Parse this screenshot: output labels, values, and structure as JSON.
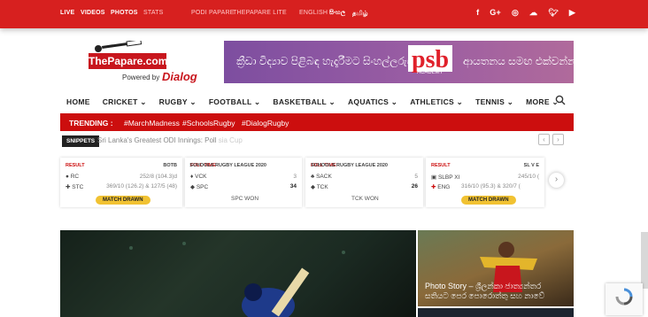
{
  "topbar": {
    "links": [
      "LIVE",
      "VIDEOS",
      "PHOTOS",
      "STATS"
    ],
    "links2": [
      "PODI PAPARE",
      "THEPAPARE LITE"
    ],
    "languages": [
      "ENGLISH",
      "සිංහල",
      "தமிழ்"
    ],
    "social_icons": [
      "facebook-icon",
      "google-plus-icon",
      "instagram-icon",
      "soundcloud-icon",
      "twitter-icon",
      "youtube-icon"
    ]
  },
  "logo": {
    "site": "ThePapare.com",
    "powered_by": "Powered by",
    "sponsor": "Dialog"
  },
  "banner": {
    "text1": "ක්‍රීඩා විද්‍යාව පිළිබඳ හැදෑරීමට සිංහල්ලරුවේ",
    "brand": "psb",
    "brand_sub": "ACADEMY",
    "text2": "ආයතනය සමඟ එක්වන්න"
  },
  "nav": {
    "items": [
      "HOME",
      "CRICKET ⌄",
      "RUGBY ⌄",
      "FOOTBALL ⌄",
      "BASKETBALL ⌄",
      "AQUATICS ⌄",
      "ATHLETICS ⌄",
      "TENNIS ⌄",
      "MORE ⌄"
    ]
  },
  "trending": {
    "label": "TRENDING :",
    "tags": [
      "#MarchMadness",
      "#SchoolsRugby",
      "#DialogRugby"
    ]
  },
  "snippets": {
    "label": "SNIPPETS",
    "text": "Sri Lanka's Greatest ODI Innings: Poll",
    "faded": "sia Cup"
  },
  "scores": [
    {
      "status": "RESULT",
      "event": "BOTB",
      "team1": "RC",
      "score1": "252/8 (104.3)d",
      "team2": "STC",
      "score2": "369/10 (126.2) & 127/5 (48)",
      "result": "MATCH DRAWN"
    },
    {
      "status": "FULL TIME",
      "event": "SCHOOLS RUGBY LEAGUE 2020",
      "team1": "VCK",
      "score1": "3",
      "team2": "SPC",
      "score2": "34",
      "result": "SPC WON"
    },
    {
      "status": "FULL TIME",
      "event": "SCHOOLS RUGBY LEAGUE 2020",
      "team1": "SACK",
      "score1": "5",
      "team2": "TCK",
      "score2": "26",
      "result": "TCK WON"
    },
    {
      "status": "RESULT",
      "event": "SL V E",
      "team1": "SLBP XI",
      "score1": "245/10 (",
      "team2": "ENG",
      "score2": "316/10 (95.3) & 320/7 (",
      "result": "MATCH DRAWN"
    }
  ],
  "photo_story": {
    "caption": "Photo Story – ශ්‍රීලන්කා ජාත්‍යන්තර සතියට පෙර පොරොත්තු සහ නාවේ"
  },
  "colors": {
    "brand_red": "#d7201f",
    "trending_red": "#cc0e0e",
    "drawn_yellow": "#f1c232"
  }
}
